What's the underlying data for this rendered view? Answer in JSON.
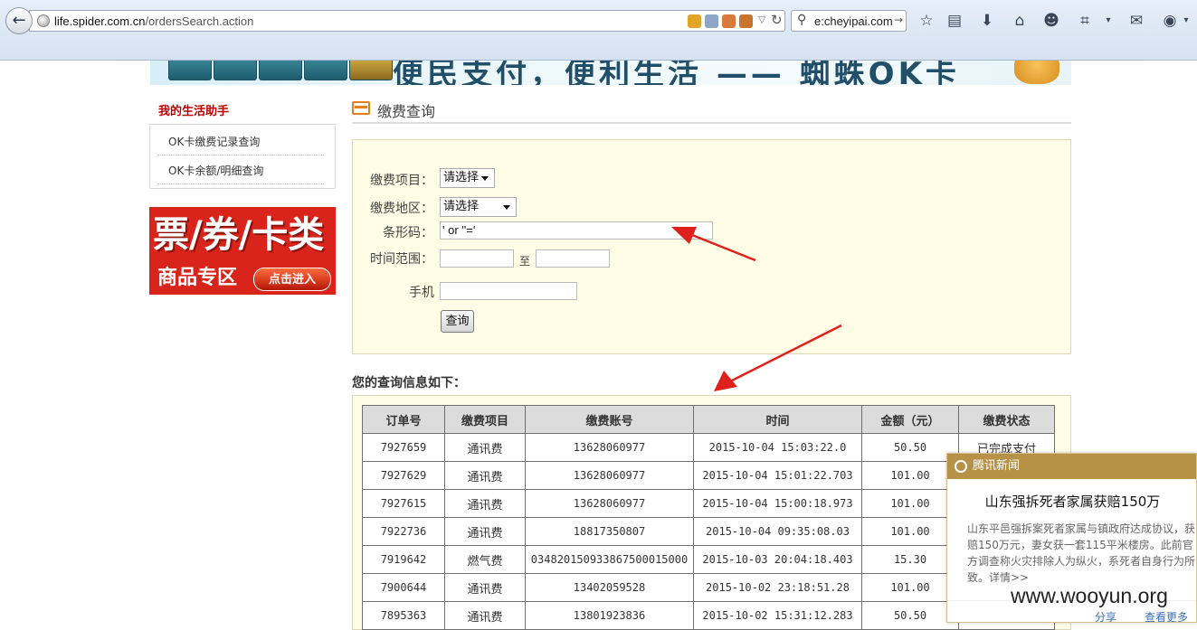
{
  "browser": {
    "url_host": "life.spider.com.cn",
    "url_path": "/ordersSearch.action",
    "search_text": "e:cheyipai.com"
  },
  "banner": {
    "slogan": "便民支付，便利生活 —— 蜘蛛OK卡"
  },
  "sidebar": {
    "title": "我的生活助手",
    "items": [
      {
        "label": "OK卡缴费记录查询"
      },
      {
        "label": "OK卡余额/明细查询"
      }
    ],
    "ad": {
      "headline": "票/券/卡类",
      "sub": "商品专区",
      "button": "点击进入"
    }
  },
  "form": {
    "section_title": "缴费查询",
    "item_label": "缴费项目：",
    "item_value": "请选择",
    "region_label": "缴费地区：",
    "region_value": "请选择",
    "barcode_label": "条形码：",
    "barcode_value": "' or ''='",
    "time_label": "时间范围：",
    "time_sep": "至",
    "phone_label": "手机",
    "submit": "查询"
  },
  "results": {
    "title": "您的查询信息如下：",
    "columns": [
      "订单号",
      "缴费项目",
      "缴费账号",
      "时间",
      "金额（元）",
      "缴费状态"
    ],
    "rows": [
      [
        "7927659",
        "通讯费",
        "13628060977",
        "2015-10-04 15:03:22.0",
        "50.50",
        "已完成支付"
      ],
      [
        "7927629",
        "通讯费",
        "13628060977",
        "2015-10-04 15:01:22.703",
        "101.00",
        ""
      ],
      [
        "7927615",
        "通讯费",
        "13628060977",
        "2015-10-04 15:00:18.973",
        "101.00",
        ""
      ],
      [
        "7922736",
        "通讯费",
        "18817350807",
        "2015-10-04 09:35:08.03",
        "101.00",
        ""
      ],
      [
        "7919642",
        "燃气费",
        "034820150933867500015000",
        "2015-10-03 20:04:18.403",
        "15.30",
        ""
      ],
      [
        "7900644",
        "通讯费",
        "13402059528",
        "2015-10-02 23:18:51.28",
        "101.00",
        ""
      ],
      [
        "7895363",
        "通讯费",
        "13801923836",
        "2015-10-02 15:31:12.283",
        "50.50",
        ""
      ]
    ]
  },
  "news": {
    "source": "腾讯新闻",
    "headline": "山东强拆死者家属获赔150万",
    "body": "山东平邑强拆案死者家属与镇政府达成协议，获赔150万元，妻女获一套115平米楼房。此前官方调查称火灾排除人为纵火，系死者自身行为所致。详情>>",
    "share": "分享",
    "more": "查看更多"
  },
  "watermark": "www.wooyun.org",
  "colors": {
    "accent_red": "#c00000",
    "panel_bg": "#fffde5",
    "arrow": "#e0201c",
    "news_header": "#b69146"
  }
}
